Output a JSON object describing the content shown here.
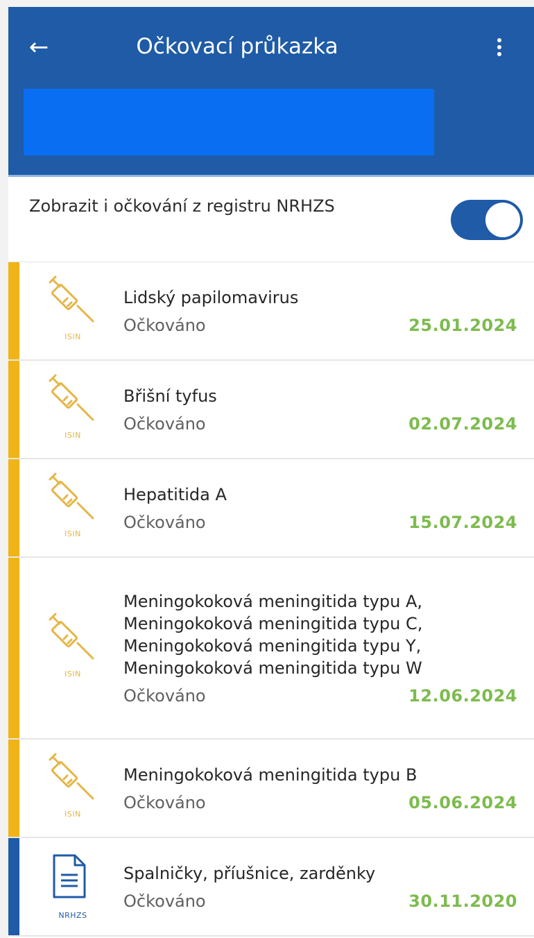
{
  "header": {
    "title": "Očkovací průkazka",
    "back_icon": "arrow-left-icon",
    "menu_icon": "more-vert-icon",
    "colors": {
      "appbar": "#1f5ba6",
      "redaction": "#0a6ef2"
    }
  },
  "filter": {
    "label": "Zobrazit i očkování z registru NRHZS",
    "enabled": true
  },
  "colors": {
    "isin_stripe": "#f0b416",
    "nrhzs_stripe": "#1f5ba6",
    "date": "#7dbb4e"
  },
  "vaccinations": [
    {
      "name": "Lidský papilomavirus",
      "status": "Očkováno",
      "date": "25.01.2024",
      "source": "ISIN",
      "icon": "syringe-icon"
    },
    {
      "name": "Břišní tyfus",
      "status": "Očkováno",
      "date": "02.07.2024",
      "source": "ISIN",
      "icon": "syringe-icon"
    },
    {
      "name": "Hepatitida A",
      "status": "Očkováno",
      "date": "15.07.2024",
      "source": "ISIN",
      "icon": "syringe-icon"
    },
    {
      "name": "Meningokoková meningitida typu A,\nMeningokoková meningitida typu C,\nMeningokoková meningitida typu Y,\nMeningokoková meningitida typu W",
      "status": "Očkováno",
      "date": "12.06.2024",
      "source": "ISIN",
      "icon": "syringe-icon"
    },
    {
      "name": "Meningokoková meningitida typu B",
      "status": "Očkováno",
      "date": "05.06.2024",
      "source": "ISIN",
      "icon": "syringe-icon"
    },
    {
      "name": "Spalničky, příušnice, zarděnky",
      "status": "Očkováno",
      "date": "30.11.2020",
      "source": "NRHZS",
      "icon": "document-icon"
    }
  ]
}
